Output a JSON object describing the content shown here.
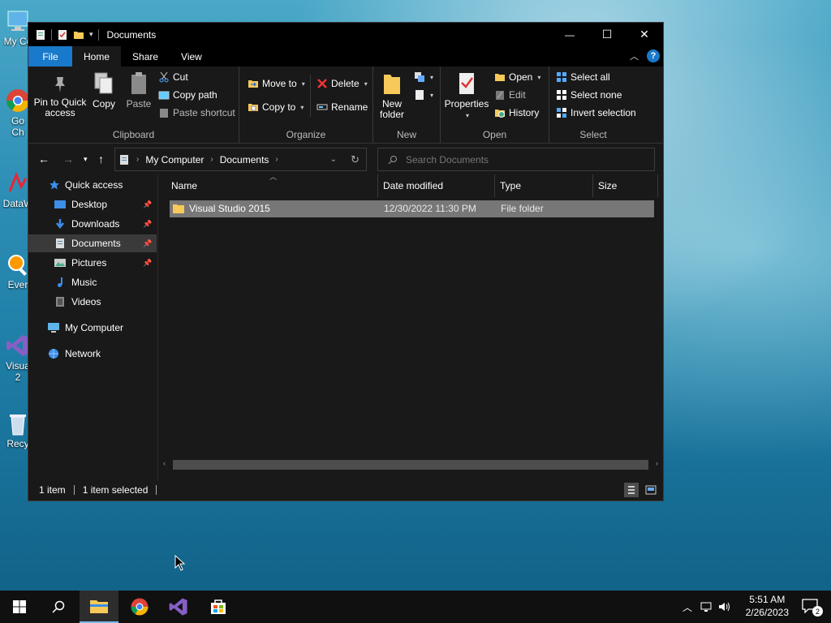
{
  "desktop": {
    "icons": [
      {
        "label": "My Co",
        "icon": "computer-icon"
      },
      {
        "label": "Go",
        "label2": "Ch",
        "icon": "chrome-icon"
      },
      {
        "label": "DataW",
        "icon": "datawrapper-icon"
      },
      {
        "label": "Ever",
        "icon": "everything-icon"
      },
      {
        "label": "Visua",
        "label2": "2",
        "icon": "visual-studio-icon"
      },
      {
        "label": "Recy",
        "icon": "recycle-bin-icon"
      }
    ]
  },
  "window": {
    "title": "Documents",
    "controls": {
      "minimize": "—",
      "maximize": "☐",
      "close": "✕"
    }
  },
  "ribbon_tabs": {
    "file": "File",
    "home": "Home",
    "share": "Share",
    "view": "View",
    "active": "Home"
  },
  "ribbon": {
    "clipboard": {
      "label": "Clipboard",
      "pin_to_quick_access_1": "Pin to Quick",
      "pin_to_quick_access_2": "access",
      "copy": "Copy",
      "paste": "Paste",
      "cut": "Cut",
      "copy_path": "Copy path",
      "paste_shortcut": "Paste shortcut"
    },
    "organize": {
      "label": "Organize",
      "move_to": "Move to",
      "copy_to": "Copy to",
      "delete": "Delete",
      "rename": "Rename"
    },
    "new": {
      "label": "New",
      "new_folder_1": "New",
      "new_folder_2": "folder"
    },
    "open": {
      "label": "Open",
      "properties": "Properties",
      "open": "Open",
      "edit": "Edit",
      "history": "History"
    },
    "select": {
      "label": "Select",
      "select_all": "Select all",
      "select_none": "Select none",
      "invert_selection": "Invert selection"
    }
  },
  "address": {
    "crumbs": [
      "My Computer",
      "Documents"
    ],
    "search_placeholder": "Search Documents"
  },
  "nav_pane": {
    "quick_access": "Quick access",
    "items": [
      {
        "label": "Desktop",
        "pinned": true
      },
      {
        "label": "Downloads",
        "pinned": true
      },
      {
        "label": "Documents",
        "pinned": true,
        "selected": true
      },
      {
        "label": "Pictures",
        "pinned": true
      },
      {
        "label": "Music",
        "pinned": false
      },
      {
        "label": "Videos",
        "pinned": false
      }
    ],
    "my_computer": "My Computer",
    "network": "Network"
  },
  "columns": [
    "Name",
    "Date modified",
    "Type",
    "Size"
  ],
  "files": [
    {
      "name": "Visual Studio 2015",
      "date_modified": "12/30/2022 11:30 PM",
      "type": "File folder",
      "size": ""
    }
  ],
  "status": {
    "count": "1 item",
    "selected": "1 item selected"
  },
  "taskbar": {
    "time": "5:51 AM",
    "date": "2/26/2023",
    "notification_count": "2"
  },
  "colors": {
    "accent": "#1979ca",
    "window_bg": "#191919",
    "selected_row": "#777777"
  }
}
